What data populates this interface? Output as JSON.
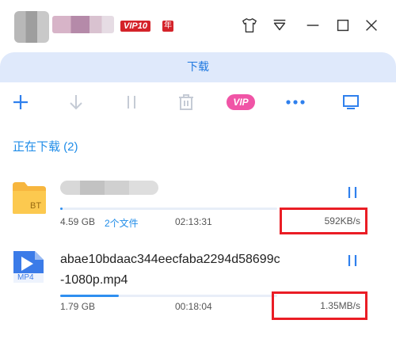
{
  "window": {
    "vip_badge": "VIP10",
    "year_badge": "年"
  },
  "panel": {
    "title": "下载",
    "section_label": "正在下载 (2)"
  },
  "toolbar": {
    "vip_label": "VIP"
  },
  "downloads": [
    {
      "type_label": "BT",
      "size": "4.59 GB",
      "file_count": "2个文件",
      "time_left": "02:13:31",
      "speed": "592KB/s",
      "progress": 0.01
    },
    {
      "type_label": "MP4",
      "name_line1": "abae10bdaac344eecfaba2294d58699c",
      "name_line2": "-1080p.mp4",
      "size": "1.79 GB",
      "time_left": "00:18:04",
      "speed": "1.35MB/s",
      "progress": 0.27
    }
  ],
  "colors": {
    "accent": "#1f78e0",
    "highlight_box": "#ea1d25",
    "vip_pink": "#f054a6",
    "badge_red": "#d4232a"
  }
}
